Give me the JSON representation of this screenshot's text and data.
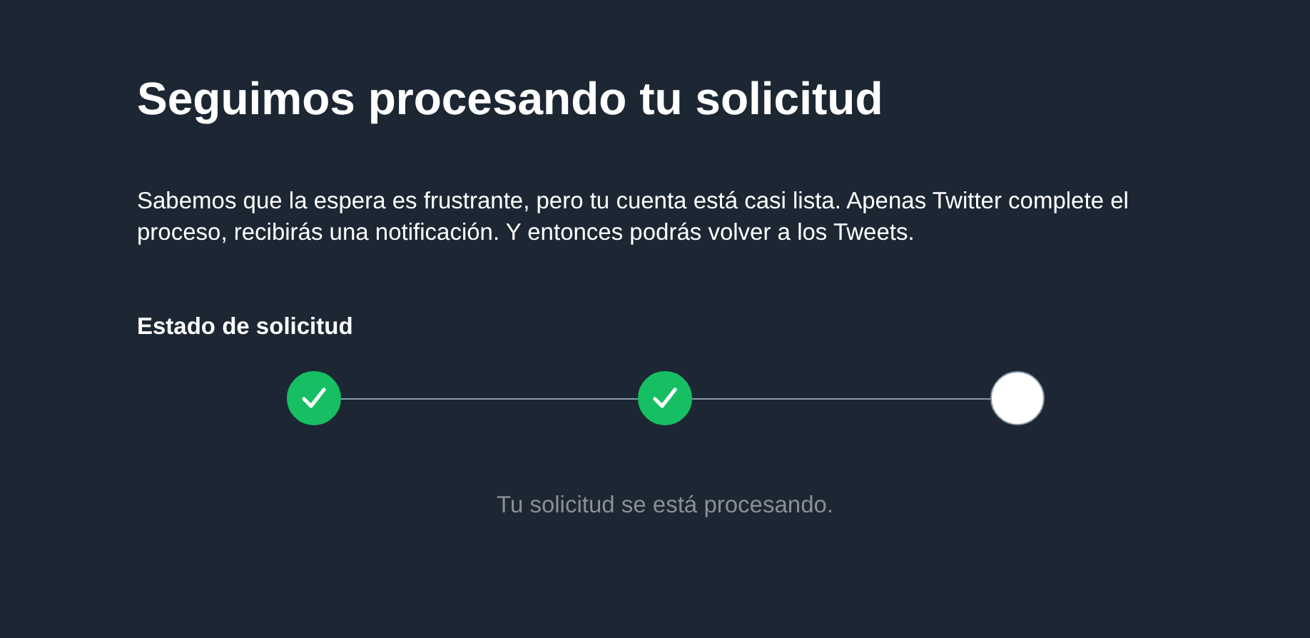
{
  "title": "Seguimos procesando tu solicitud",
  "message": "Sabemos que la espera es frustrante, pero tu cuenta está casi lista. Apenas Twitter complete el proceso, recibirás una notificación. Y entonces podrás volver a los Tweets.",
  "status_label": "Estado de solicitud",
  "steps": [
    {
      "done": true
    },
    {
      "done": true
    },
    {
      "done": false
    }
  ],
  "status_text": "Tu solicitud se está procesando."
}
